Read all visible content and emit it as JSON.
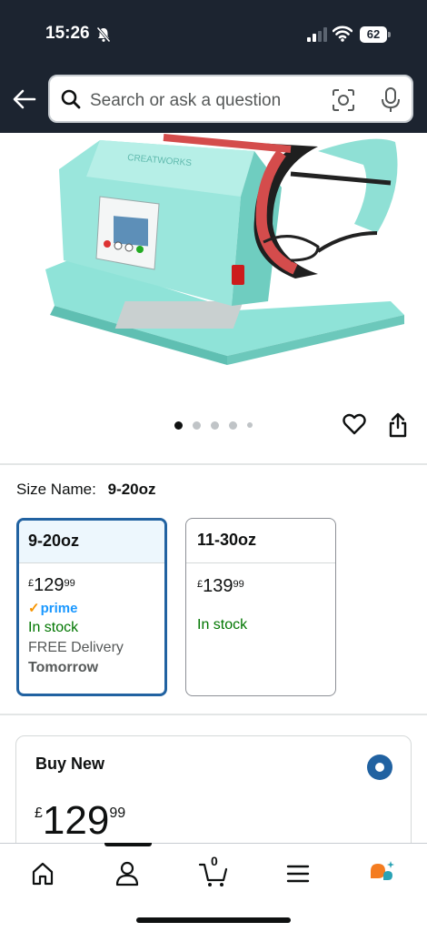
{
  "status_bar": {
    "time": "15:26",
    "battery": "62"
  },
  "search": {
    "placeholder": "Search or ask a question"
  },
  "carousel": {
    "total_images": 5,
    "active_index": 0
  },
  "size": {
    "label": "Size Name:",
    "selected": "9-20oz",
    "options": [
      {
        "name": "9-20oz",
        "currency": "£",
        "price_whole": "129",
        "price_fraction": "99",
        "prime": "prime",
        "stock": "In stock",
        "delivery": "FREE Delivery",
        "delivery_day": "Tomorrow",
        "selected": true
      },
      {
        "name": "11-30oz",
        "currency": "£",
        "price_whole": "139",
        "price_fraction": "99",
        "stock": "In stock",
        "selected": false
      }
    ]
  },
  "buy_box": {
    "title": "Buy New",
    "currency": "£",
    "price_whole": "129",
    "price_fraction": "99"
  },
  "bottom_nav": {
    "cart_count": "0"
  },
  "colors": {
    "header_bg": "#1c2430",
    "selected_border": "#2162a1",
    "stock_green": "#007600",
    "prime_blue": "#1a98ff",
    "product_color": "#7fded2"
  }
}
